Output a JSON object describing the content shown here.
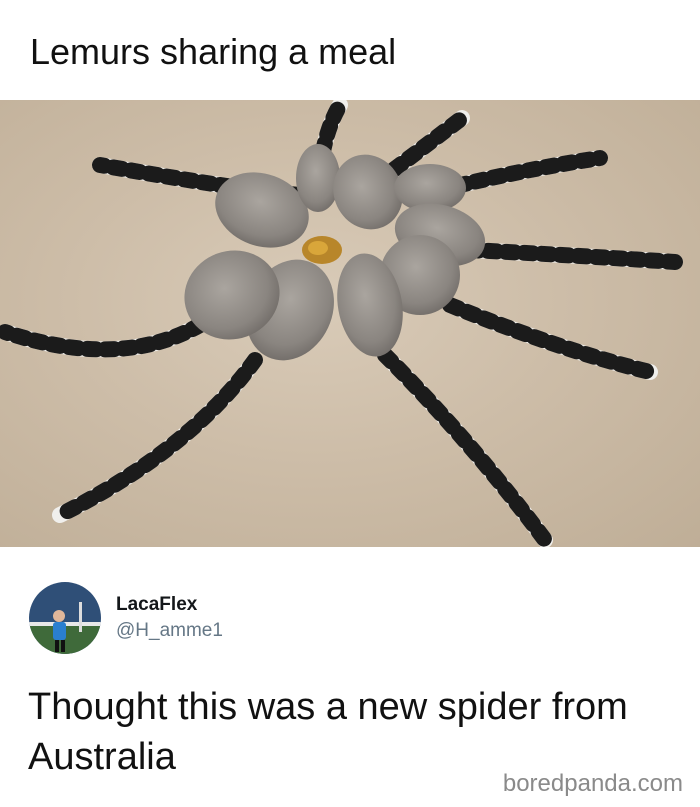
{
  "meme": {
    "title": "Lemurs sharing a meal"
  },
  "tweet": {
    "display_name": "LacaFlex",
    "handle": "@H_amme1",
    "text": "Thought this was a new spider from Australia"
  },
  "watermark": "boredpanda.com",
  "colors": {
    "floor": "#cdbda8",
    "lemur_fur": "#8f8b86",
    "tail_dark": "#1c1c1c",
    "tail_light": "#f2f2f2",
    "handle_gray": "#657786"
  }
}
